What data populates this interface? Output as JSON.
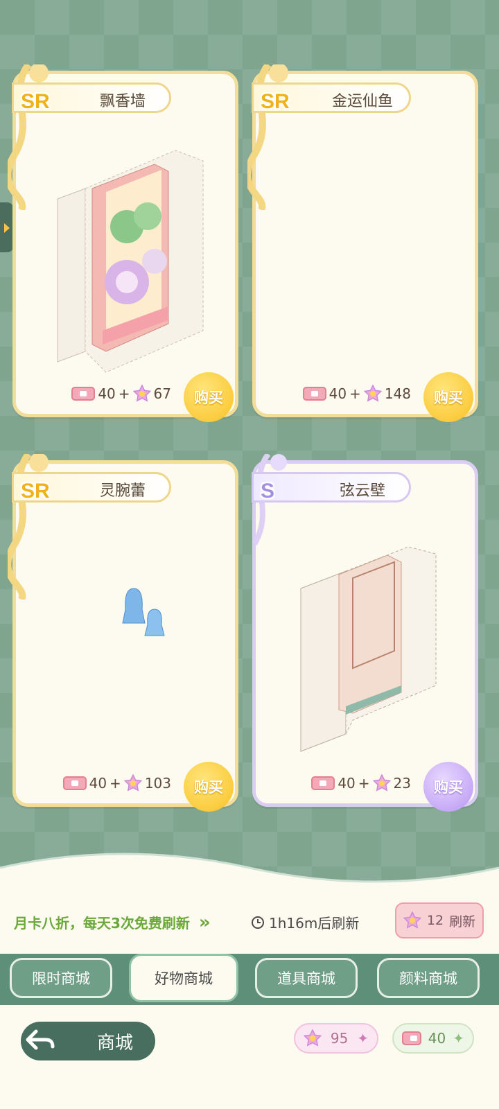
{
  "cards": [
    {
      "rarity": "SR",
      "name": "飘香墙",
      "ticket_price": "40",
      "plus": "+",
      "star_price": "67",
      "buy_label": "购买"
    },
    {
      "rarity": "SR",
      "name": "金运仙鱼",
      "ticket_price": "40",
      "plus": "+",
      "star_price": "148",
      "buy_label": "购买"
    },
    {
      "rarity": "SR",
      "name": "灵腕蕾",
      "ticket_price": "40",
      "plus": "+",
      "star_price": "103",
      "buy_label": "购买"
    },
    {
      "rarity": "S",
      "name": "弦云壁",
      "ticket_price": "40",
      "plus": "+",
      "star_price": "23",
      "buy_label": "购买"
    }
  ],
  "info": {
    "promo_text": "月卡八折，每天3次免费刷新",
    "promo_arrow": "»",
    "timer_text": "1h16m后刷新",
    "refresh_cost": "12",
    "refresh_label": "刷新"
  },
  "tabs": [
    {
      "label": "限时商城"
    },
    {
      "label": "好物商城",
      "active": true
    },
    {
      "label": "道具商城"
    },
    {
      "label": "颜料商城"
    }
  ],
  "bottom": {
    "title": "商城",
    "star_balance": "95",
    "ticket_balance": "40"
  },
  "colors": {
    "gold": "#f0b21b",
    "lavender": "#a58fe0",
    "green": "#6aa83a",
    "bg": "#7fa58f"
  }
}
